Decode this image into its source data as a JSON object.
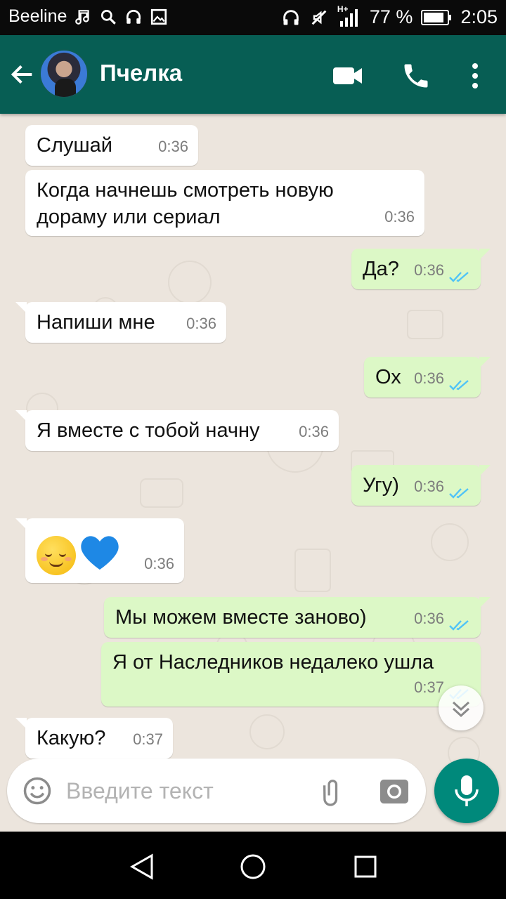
{
  "status_bar": {
    "carrier": "Beeline",
    "network": "H+",
    "battery": "77 %",
    "time": "2:05"
  },
  "header": {
    "contact_name": "Пчелка",
    "icons": [
      "back-arrow-icon",
      "video-call-icon",
      "phone-icon",
      "more-vert-icon"
    ]
  },
  "messages": [
    {
      "dir": "in",
      "text": "Слушай",
      "time": "0:36"
    },
    {
      "dir": "in",
      "text": "Когда начнешь смотреть новую",
      "text2": "дораму или сериал",
      "time": "0:36"
    },
    {
      "dir": "out",
      "text": "Да?",
      "time": "0:36",
      "status": "read"
    },
    {
      "dir": "in",
      "text": "Напиши мне",
      "time": "0:36"
    },
    {
      "dir": "out",
      "text": "Ох",
      "time": "0:36",
      "status": "read"
    },
    {
      "dir": "in",
      "text": "Я вместе с тобой начну",
      "time": "0:36"
    },
    {
      "dir": "out",
      "text": "Угу)",
      "time": "0:36",
      "status": "read"
    },
    {
      "dir": "in",
      "emoji": [
        "relieved-face",
        "blue-heart"
      ],
      "time": "0:36"
    },
    {
      "dir": "out",
      "text": "Мы можем вместе заново)",
      "time": "0:36",
      "status": "read"
    },
    {
      "dir": "out",
      "text": "Я от Наследников недалеко ушла",
      "time": "0:37",
      "status": "read"
    },
    {
      "dir": "in",
      "text": "Какую?",
      "time": "0:37"
    }
  ],
  "composer": {
    "placeholder": "Введите текст"
  },
  "colors": {
    "appbar": "#075e54",
    "chat_bg": "#ece5dd",
    "outgoing_bubble": "#dcf8c6",
    "incoming_bubble": "#ffffff",
    "read_ticks": "#4fc3f7",
    "mic_button": "#00897b"
  }
}
